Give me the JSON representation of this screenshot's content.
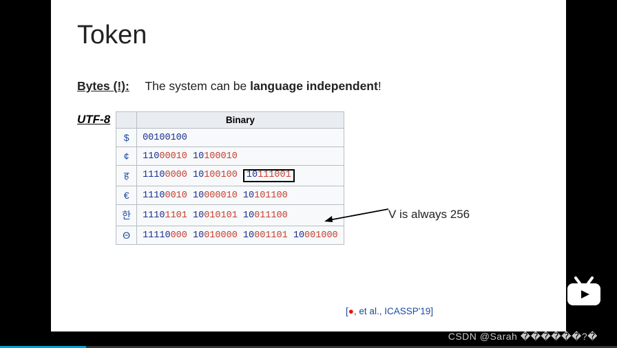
{
  "slide": {
    "title": "Token",
    "bytes_label": "Bytes (!):",
    "bytes_text_pre": "The system can be ",
    "bytes_text_bold": "language independent",
    "bytes_text_post": "!",
    "utf8_label": "UTF-8",
    "table_header": "Binary",
    "rows": [
      {
        "sym": "$",
        "parts": [
          [
            "00100100"
          ]
        ]
      },
      {
        "sym": "¢",
        "parts": [
          [
            "110",
            "00010"
          ],
          [
            "10",
            "100010"
          ]
        ]
      },
      {
        "sym": "ह",
        "parts": [
          [
            "1110",
            "0000"
          ],
          [
            "10",
            "100100"
          ],
          [
            "10",
            "111001"
          ]
        ],
        "boxed_index": 2
      },
      {
        "sym": "€",
        "parts": [
          [
            "1110",
            "0010"
          ],
          [
            "10",
            "000010"
          ],
          [
            "10",
            "101100"
          ]
        ]
      },
      {
        "sym": "한",
        "parts": [
          [
            "1110",
            "1101"
          ],
          [
            "10",
            "010101"
          ],
          [
            "10",
            "011100"
          ]
        ]
      },
      {
        "sym": "Θ",
        "parts": [
          [
            "11110",
            "000"
          ],
          [
            "10",
            "010000"
          ],
          [
            "10",
            "001101"
          ],
          [
            "10",
            "001000"
          ]
        ]
      }
    ],
    "annotation": "V is always 256",
    "citation_prefix": "[",
    "citation_cursor": "●",
    "citation_text": ", et al., ICASSP'19]"
  },
  "watermark": "CSDN @Sarah ������?�",
  "player": {
    "progress_percent": 14
  }
}
